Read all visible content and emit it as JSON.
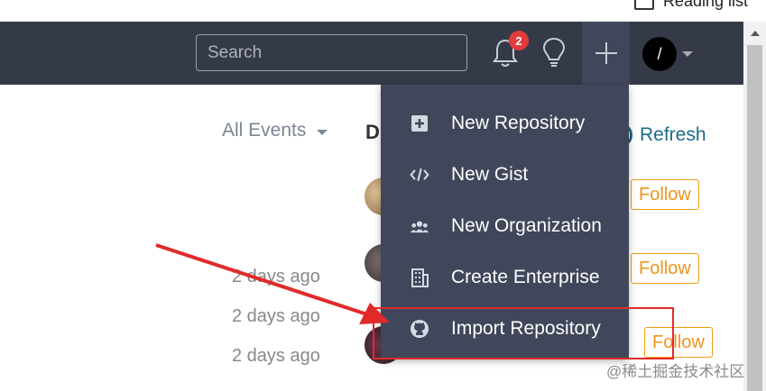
{
  "browser": {
    "reading_list": "Reading list"
  },
  "header": {
    "search_placeholder": "Search",
    "notification_count": "2",
    "avatar_initial": "/"
  },
  "menu": {
    "items": [
      {
        "label": "New Repository",
        "icon": "plus-square-icon"
      },
      {
        "label": "New Gist",
        "icon": "code-icon"
      },
      {
        "label": "New Organization",
        "icon": "people-icon"
      },
      {
        "label": "Create Enterprise",
        "icon": "building-icon"
      },
      {
        "label": "Import Repository",
        "icon": "github-icon"
      }
    ]
  },
  "content": {
    "filter_label": "All Events",
    "partial_heading": "D",
    "refresh_label": "Refresh",
    "follow_label": "Follow",
    "times": [
      "2 days ago",
      "2 days ago",
      "2 days ago"
    ],
    "watermark": "@稀土掘金技术社区"
  },
  "colors": {
    "header_bg": "#353a48",
    "menu_bg": "#40475a",
    "accent_orange": "#f0941a",
    "link_blue": "#1d6b8a",
    "annotation_red": "#e02a2a"
  }
}
